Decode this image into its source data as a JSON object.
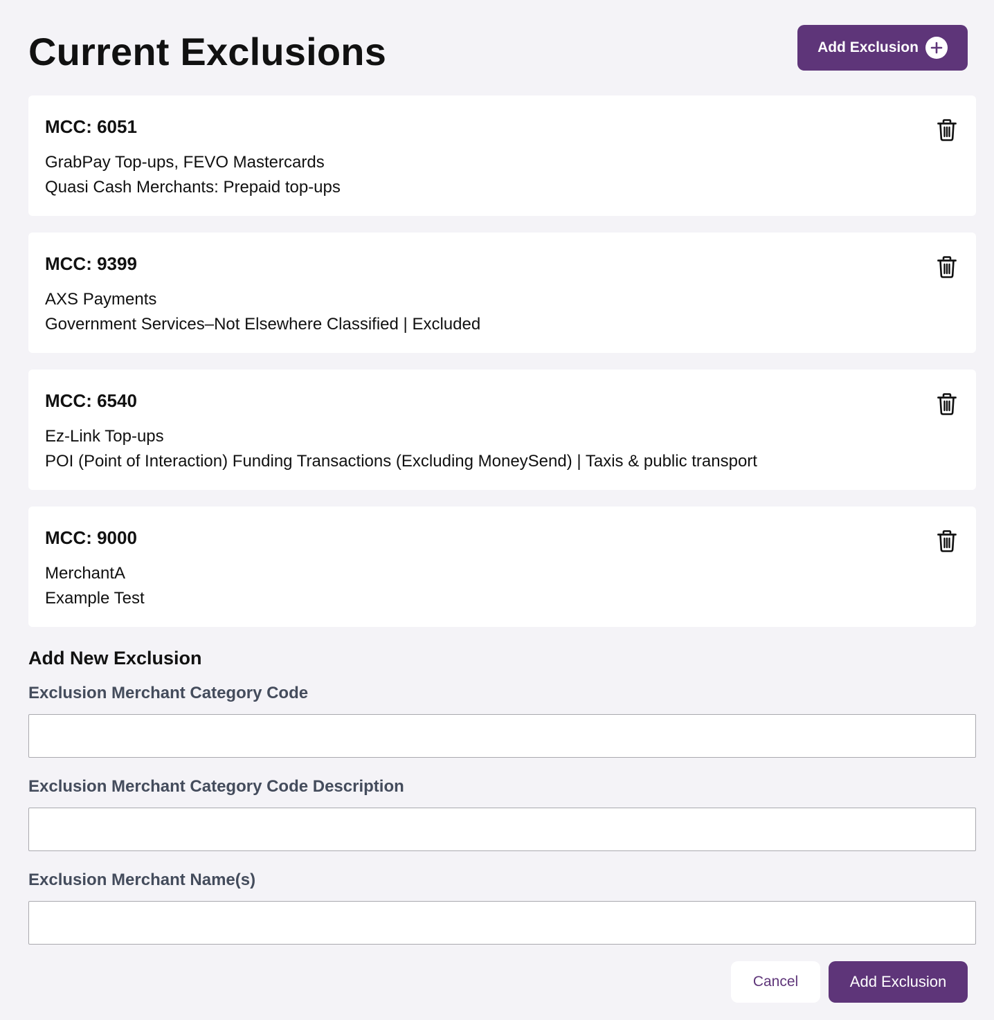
{
  "header": {
    "title": "Current Exclusions",
    "add_button_label": "Add Exclusion"
  },
  "exclusions": [
    {
      "code": "MCC: 6051",
      "merchants": "GrabPay Top-ups, FEVO Mastercards",
      "description": "Quasi Cash Merchants: Prepaid top-ups"
    },
    {
      "code": "MCC: 9399",
      "merchants": "AXS Payments",
      "description": "Government Services–Not Elsewhere Classified | Excluded"
    },
    {
      "code": "MCC: 6540",
      "merchants": "Ez-Link Top-ups",
      "description": "POI (Point of Interaction) Funding Transactions (Excluding MoneySend) | Taxis & public transport"
    },
    {
      "code": "MCC: 9000",
      "merchants": "MerchantA",
      "description": "Example Test"
    }
  ],
  "form": {
    "title": "Add New Exclusion",
    "code_label": "Exclusion Merchant Category Code",
    "code_value": "",
    "description_label": "Exclusion Merchant Category Code Description",
    "description_value": "",
    "names_label": "Exclusion Merchant Name(s)",
    "names_value": "",
    "cancel_label": "Cancel",
    "submit_label": "Add Exclusion"
  },
  "colors": {
    "brand": "#5e3579",
    "background": "#f4f3f7",
    "card": "#ffffff",
    "label": "#444c5c"
  },
  "icons": {
    "add": "plus-circle-icon",
    "delete": "trash-icon"
  }
}
